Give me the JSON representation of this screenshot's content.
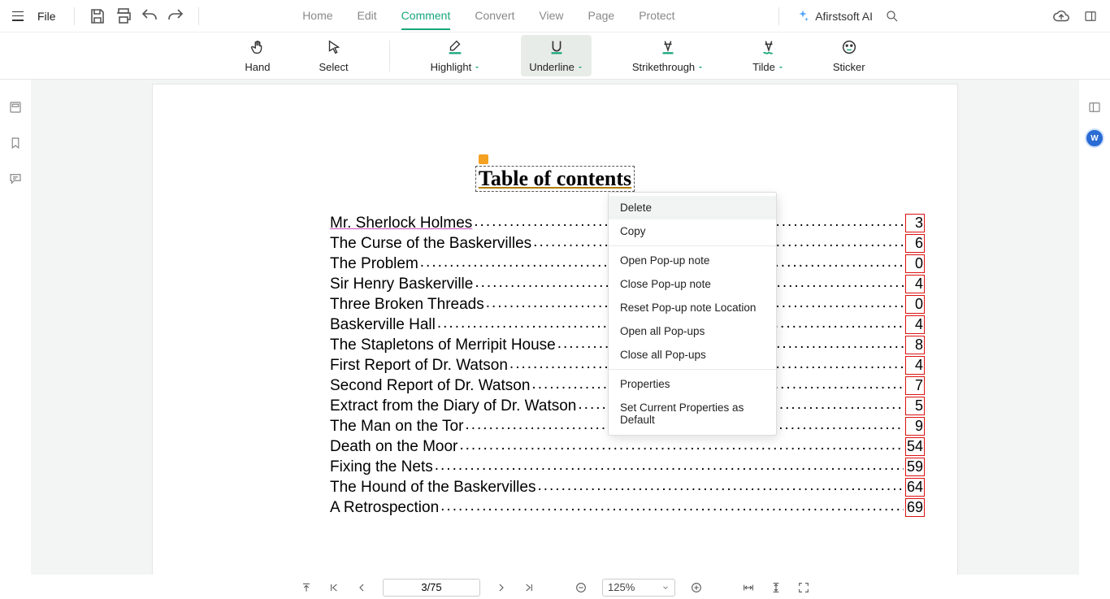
{
  "titlebar": {
    "file_label": "File",
    "tabs": [
      "Home",
      "Edit",
      "Comment",
      "Convert",
      "View",
      "Page",
      "Protect"
    ],
    "active_tab_index": 2,
    "ai_label": "Afirstsoft AI"
  },
  "ribbon": {
    "items": [
      {
        "label": "Hand",
        "has_dd": false
      },
      {
        "label": "Select",
        "has_dd": false
      },
      {
        "label": "Highlight",
        "has_dd": true
      },
      {
        "label": "Underline",
        "has_dd": true
      },
      {
        "label": "Strikethrough",
        "has_dd": true
      },
      {
        "label": "Tilde",
        "has_dd": true
      },
      {
        "label": "Sticker",
        "has_dd": false
      }
    ],
    "active_index": 3
  },
  "document": {
    "title": "Table of contents",
    "toc": [
      {
        "title": "Mr. Sherlock Holmes",
        "page": "3"
      },
      {
        "title": "The Curse of the Baskervilles",
        "page": "6"
      },
      {
        "title": "The Problem",
        "page": "0"
      },
      {
        "title": "Sir Henry Baskerville",
        "page": "4"
      },
      {
        "title": "Three Broken Threads",
        "page": "0"
      },
      {
        "title": "Baskerville Hall",
        "page": "4"
      },
      {
        "title": "The Stapletons of Merripit House",
        "page": "8"
      },
      {
        "title": "First Report of Dr. Watson",
        "page": "4"
      },
      {
        "title": "Second Report of Dr. Watson",
        "page": "7"
      },
      {
        "title": "Extract from the Diary of Dr. Watson",
        "page": "5"
      },
      {
        "title": "The Man on the Tor",
        "page": "9"
      },
      {
        "title": "Death on the Moor",
        "page": "54"
      },
      {
        "title": "Fixing the Nets",
        "page": "59"
      },
      {
        "title": "The Hound of the Baskervilles",
        "page": "64"
      },
      {
        "title": "A Retrospection",
        "page": "69"
      }
    ]
  },
  "context_menu": {
    "items": [
      "Delete",
      "Copy",
      "Open Pop-up note",
      "Close Pop-up note",
      "Reset Pop-up note Location",
      "Open all Pop-ups",
      "Close all Pop-ups",
      "Properties",
      "Set Current Properties as Default"
    ],
    "separators_after": [
      1,
      6
    ],
    "hover_index": 0
  },
  "bottombar": {
    "page_display": "3/75",
    "zoom": "125%"
  },
  "right_rail": {
    "word_badge": "W"
  }
}
